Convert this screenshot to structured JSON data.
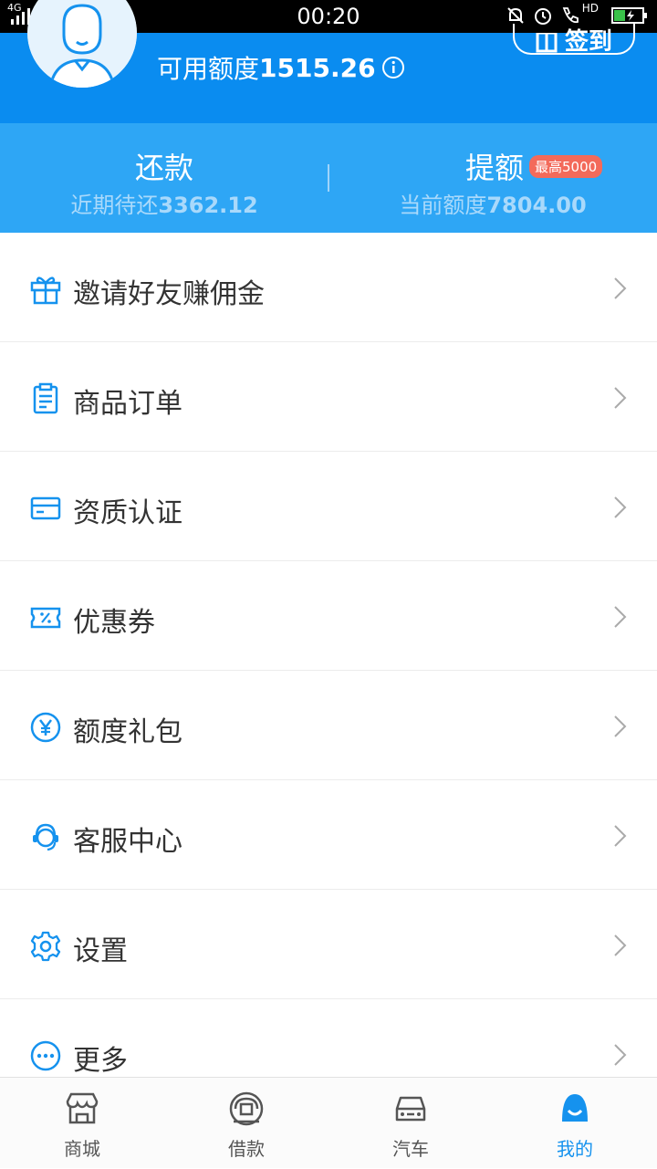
{
  "status_bar": {
    "network": "4G",
    "time": "00:20",
    "hd": "HD"
  },
  "header": {
    "credit_label": "可用额度",
    "credit_amount": "1515.26",
    "signin_label": "签到"
  },
  "stats": {
    "repay": {
      "title": "还款",
      "sub_label": "近期待还",
      "sub_value": "3362.12"
    },
    "raise": {
      "title": "提额",
      "badge": "最高5000",
      "sub_label": "当前额度",
      "sub_value": "7804.00"
    }
  },
  "menu": [
    {
      "label": "邀请好友赚佣金",
      "icon": "gift-icon"
    },
    {
      "label": "商品订单",
      "icon": "clipboard-icon"
    },
    {
      "label": "资质认证",
      "icon": "card-icon"
    },
    {
      "label": "优惠券",
      "icon": "coupon-icon"
    },
    {
      "label": "额度礼包",
      "icon": "yen-icon"
    },
    {
      "label": "客服中心",
      "icon": "headset-icon"
    },
    {
      "label": "设置",
      "icon": "settings-icon"
    },
    {
      "label": "更多",
      "icon": "more-icon"
    }
  ],
  "tabs": [
    {
      "label": "商城",
      "icon": "store-icon"
    },
    {
      "label": "借款",
      "icon": "loan-icon"
    },
    {
      "label": "汽车",
      "icon": "car-icon"
    },
    {
      "label": "我的",
      "icon": "profile-icon",
      "active": true
    }
  ],
  "colors": {
    "header_blue": "#0a8cf0",
    "band_blue": "#2ea6f5",
    "accent_blue": "#1592ee",
    "badge_red": "#f36a5a"
  }
}
